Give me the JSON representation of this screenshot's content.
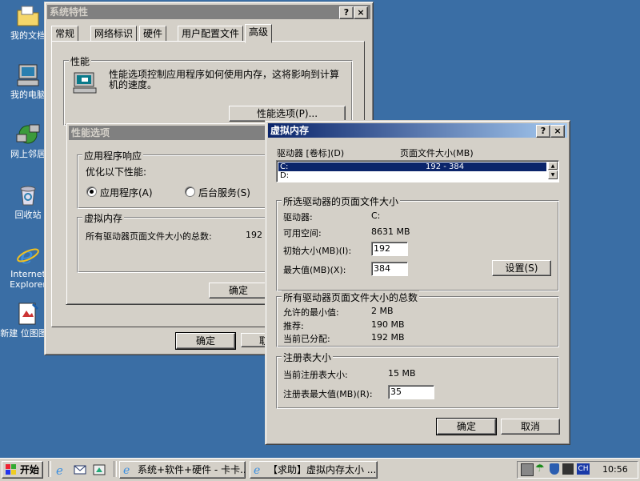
{
  "desktop": {
    "icons": [
      {
        "label": "我的文档"
      },
      {
        "label": "我的电脑"
      },
      {
        "label": "网上邻居"
      },
      {
        "label": "回收站"
      },
      {
        "label": "Internet Explorer"
      },
      {
        "label": "新建 位图图像"
      }
    ]
  },
  "sysprops": {
    "title": "系统特性",
    "tabs": [
      "常规",
      "网络标识",
      "硬件",
      "用户配置文件",
      "高级"
    ],
    "perf_group": "性能",
    "perf_desc": "性能选项控制应用程序如何使用内存，这将影响到计算机的速度。",
    "perf_btn": "性能选项(P)...",
    "ok": "确定",
    "cancel": "取"
  },
  "perfopts": {
    "title": "性能选项",
    "app_group": "应用程序响应",
    "optimize": "优化以下性能:",
    "radio_apps": "应用程序(A)",
    "radio_bg": "后台服务(S)",
    "vm_group": "虚拟内存",
    "vm_total": "所有驱动器页面文件大小的总数:",
    "vm_total_val": "192",
    "ok": "确定"
  },
  "vmem": {
    "title": "虚拟内存",
    "col_drive": "驱动器 [卷标](D)",
    "col_size": "页面文件大小(MB)",
    "drives": [
      {
        "drive": "C:",
        "size": "192 - 384"
      },
      {
        "drive": "D:",
        "size": ""
      }
    ],
    "sel_group": "所选驱动器的页面文件大小",
    "drive_lbl": "驱动器:",
    "drive_val": "C:",
    "free_lbl": "可用空间:",
    "free_val": "8631 MB",
    "init_lbl": "初始大小(MB)(I):",
    "init_val": "192",
    "max_lbl": "最大值(MB)(X):",
    "max_val": "384",
    "set_btn": "设置(S)",
    "total_group": "所有驱动器页面文件大小的总数",
    "min_lbl": "允许的最小值:",
    "min_val": "2 MB",
    "rec_lbl": "推荐:",
    "rec_val": "190 MB",
    "alloc_lbl": "当前已分配:",
    "alloc_val": "192 MB",
    "reg_group": "注册表大小",
    "reg_cur_lbl": "当前注册表大小:",
    "reg_cur_val": "15 MB",
    "reg_max_lbl": "注册表最大值(MB)(R):",
    "reg_max_val": "35",
    "ok": "确定",
    "cancel": "取消"
  },
  "taskbar": {
    "start": "开始",
    "tasks": [
      "系统+软件+硬件 - 卡卡...",
      "【求助】虚拟内存太小 ..."
    ],
    "clock": "10:56",
    "lang": "CH"
  },
  "colors": {
    "desktop": "#3a6ea5",
    "title_active": "#0a246a",
    "title_inactive": "#808080",
    "face": "#d4d0c8"
  }
}
